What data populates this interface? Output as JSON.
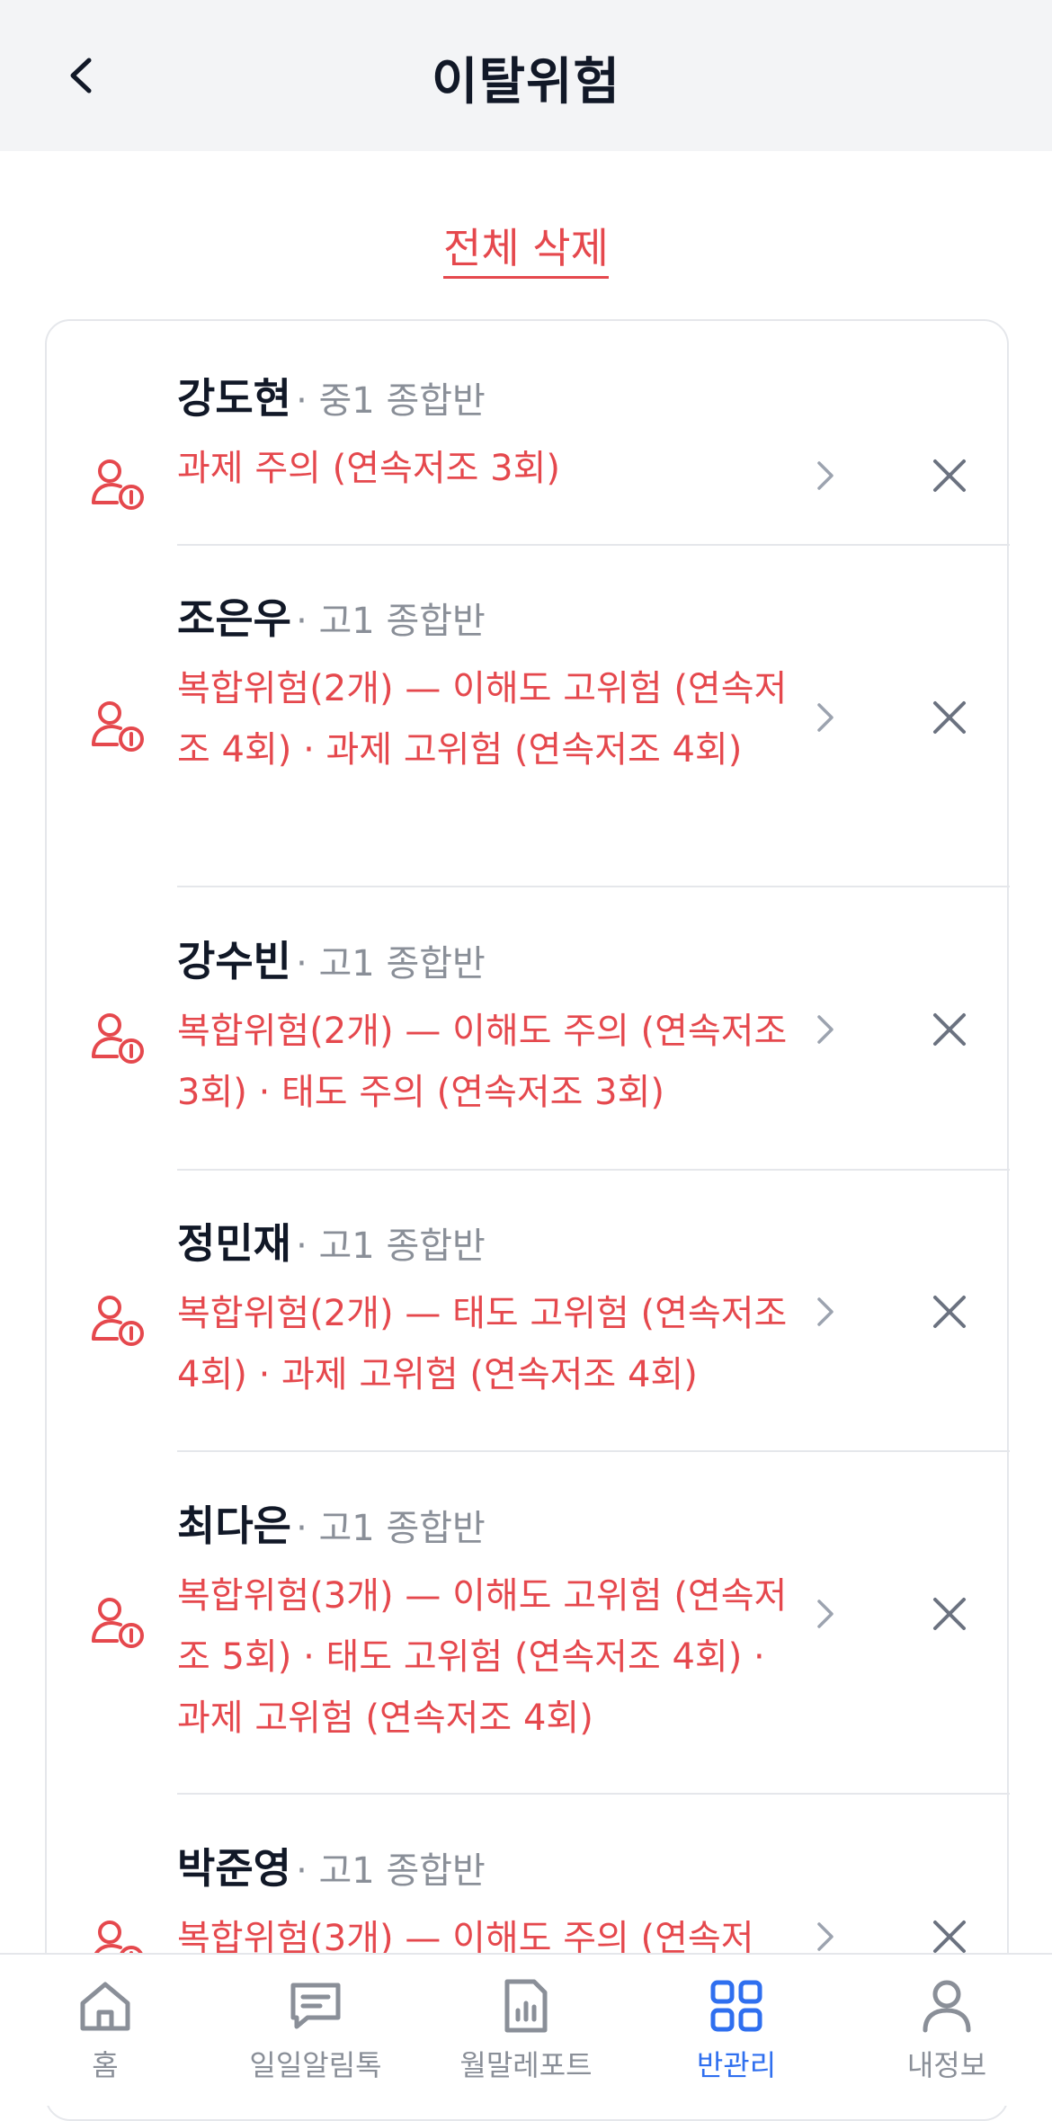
{
  "header": {
    "title": "이탈위험"
  },
  "actions": {
    "delete_all": "전체 삭제"
  },
  "students": [
    {
      "name": "강도현",
      "meta": "· 중1 종합반",
      "risk": "과제 주의 (연속저조 3회)"
    },
    {
      "name": "조은우",
      "meta": "· 고1 종합반",
      "risk": "복합위험(2개) — 이해도 고위험 (연속저조 4회) · 과제 고위험 (연속저조 4회)"
    },
    {
      "name": "강수빈",
      "meta": "· 고1 종합반",
      "risk": "복합위험(2개) — 이해도 주의 (연속저조 3회) · 태도 주의 (연속저조 3회)"
    },
    {
      "name": "정민재",
      "meta": "· 고1 종합반",
      "risk": "복합위험(2개) — 태도 고위험 (연속저조 4회) · 과제 고위험 (연속저조 4회)"
    },
    {
      "name": "최다은",
      "meta": "· 고1 종합반",
      "risk": "복합위험(3개) — 이해도 고위험 (연속저조 5회) · 태도 고위험 (연속저조 4회) · 과제 고위험 (연속저조 4회)"
    },
    {
      "name": "박준영",
      "meta": "· 고1 종합반",
      "risk": "복합위험(3개) — 이해도 주의 (연속저"
    }
  ],
  "nav": [
    {
      "label": "홈",
      "icon": "home-icon"
    },
    {
      "label": "일일알림톡",
      "icon": "message-icon"
    },
    {
      "label": "월말레포트",
      "icon": "report-icon"
    },
    {
      "label": "반관리",
      "icon": "grid-icon",
      "active": true
    },
    {
      "label": "내정보",
      "icon": "user-icon"
    }
  ],
  "colors": {
    "accent": "#2f6fef",
    "danger": "#e5484d",
    "muted": "#8a8f98",
    "header_bg": "#f3f4f6"
  }
}
